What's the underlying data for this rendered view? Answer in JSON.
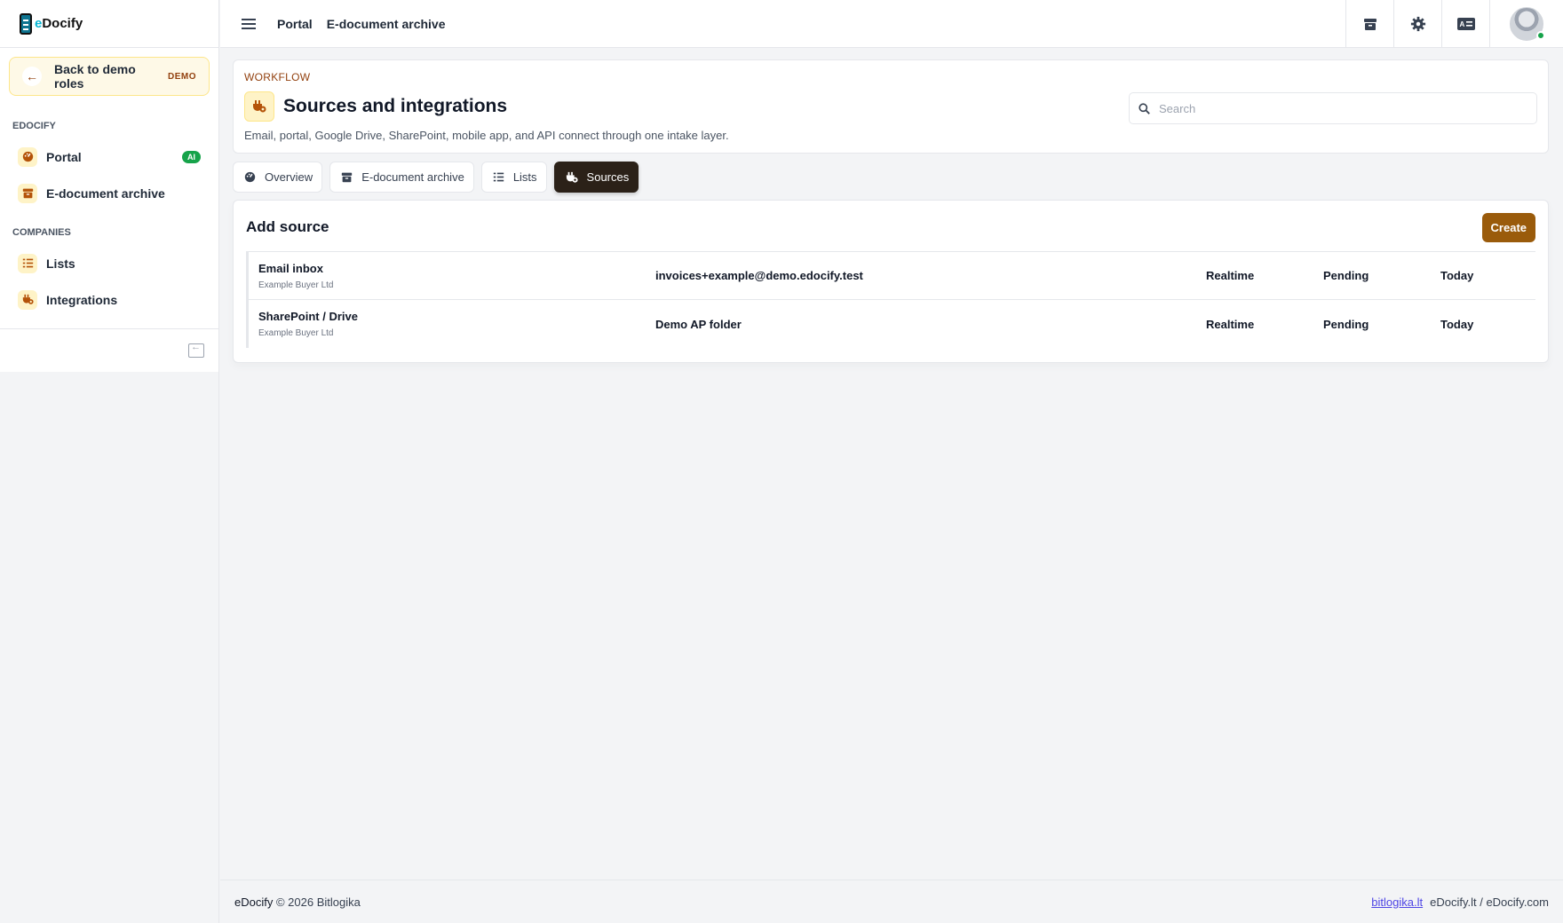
{
  "app": {
    "logo_prefix": "e",
    "logo_name": "Docify"
  },
  "sidebar": {
    "back_label": "Back to demo roles",
    "back_badge": "DEMO",
    "sections": [
      {
        "title": "EDOCIFY",
        "items": [
          {
            "label": "Portal",
            "icon": "dashboard-icon",
            "badge": "AI"
          },
          {
            "label": "E-document archive",
            "icon": "archive-icon"
          }
        ]
      },
      {
        "title": "COMPANIES",
        "items": [
          {
            "label": "Lists",
            "icon": "list-icon"
          },
          {
            "label": "Integrations",
            "icon": "plug-icon"
          }
        ]
      }
    ]
  },
  "topbar": {
    "breadcrumb": [
      "Portal",
      "E-document archive"
    ],
    "icons": [
      "archive-icon",
      "gear-icon",
      "id-card-icon"
    ]
  },
  "header": {
    "eyebrow": "WORKFLOW",
    "title": "Sources and integrations",
    "subtitle": "Email, portal, Google Drive, SharePoint, mobile app, and API connect through one intake layer.",
    "search_placeholder": "Search"
  },
  "tabs": [
    {
      "label": "Overview",
      "icon": "dashboard-icon",
      "active": false
    },
    {
      "label": "E-document archive",
      "icon": "archive-icon",
      "active": false
    },
    {
      "label": "Lists",
      "icon": "list-icon",
      "active": false
    },
    {
      "label": "Sources",
      "icon": "plug-icon",
      "active": true
    }
  ],
  "card": {
    "title": "Add source",
    "create_label": "Create",
    "rows": [
      {
        "name": "Email inbox",
        "company": "Example Buyer Ltd",
        "target": "invoices+example@demo.edocify.test",
        "mode": "Realtime",
        "status": "Pending",
        "when": "Today"
      },
      {
        "name": "SharePoint / Drive",
        "company": "Example Buyer Ltd",
        "target": "Demo AP folder",
        "mode": "Realtime",
        "status": "Pending",
        "when": "Today"
      }
    ]
  },
  "footer": {
    "brand": "eDocify",
    "copyright": "© 2026 Bitlogika",
    "link": "bitlogika.lt",
    "domains": "eDocify.lt / eDocify.com"
  },
  "colors": {
    "accent": "#9a5b0b",
    "active_tab": "#2b2118",
    "ai_badge": "#16a34a"
  }
}
